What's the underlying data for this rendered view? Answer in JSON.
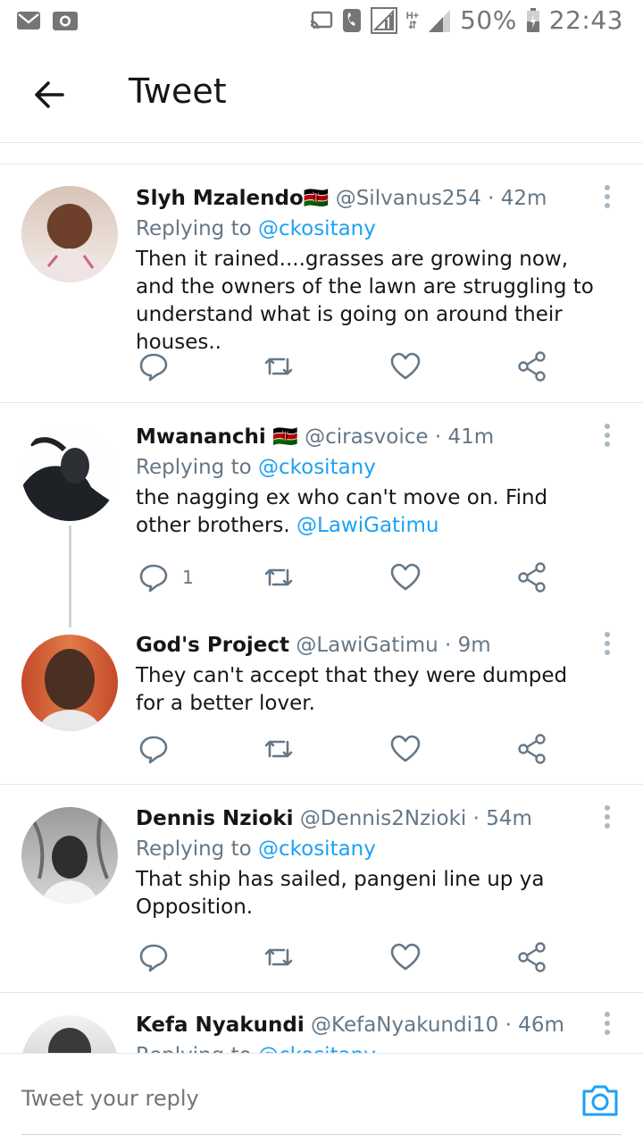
{
  "statusbar": {
    "battery": "50%",
    "time": "22:43",
    "network": "H+"
  },
  "header": {
    "title": "Tweet"
  },
  "colors": {
    "link": "#1da1f2",
    "secondary": "#657786",
    "icon": "#657786"
  },
  "tweets": [
    {
      "name": "Slyh Mzalendo",
      "flag": "🇰🇪",
      "handle": "@Silvanus254",
      "time": "· 42m",
      "replying_prefix": "Replying to",
      "replying_to": "@ckositany",
      "text": "Then it rained....grasses are growing now, and the owners of the lawn are struggling to understand what is going on around their houses..",
      "reply_count": ""
    },
    {
      "name": "Mwananchi",
      "flag": "🇰🇪",
      "handle": "@cirasvoice",
      "time": "· 41m",
      "replying_prefix": "Replying to",
      "replying_to": "@ckositany",
      "text": "the nagging ex who can't move on. Find other brothers.",
      "mention": "@LawiGatimu",
      "reply_count": "1"
    },
    {
      "name": "God's Project",
      "handle": "@LawiGatimu",
      "time": "· 9m",
      "text": "They can't accept that they were dumped for a better lover.",
      "reply_count": ""
    },
    {
      "name": "Dennis Nzioki",
      "handle": "@Dennis2Nzioki",
      "time": "· 54m",
      "replying_prefix": "Replying to",
      "replying_to": "@ckositany",
      "text": "That ship has sailed, pangeni line up ya Opposition.",
      "reply_count": ""
    },
    {
      "name": "Kefa Nyakundi",
      "handle": "@KefaNyakundi10",
      "time": "· 46m",
      "replying_prefix": "Replying to",
      "replying_to": "@ckositany"
    }
  ],
  "reply_bar": {
    "placeholder": "Tweet your reply"
  }
}
